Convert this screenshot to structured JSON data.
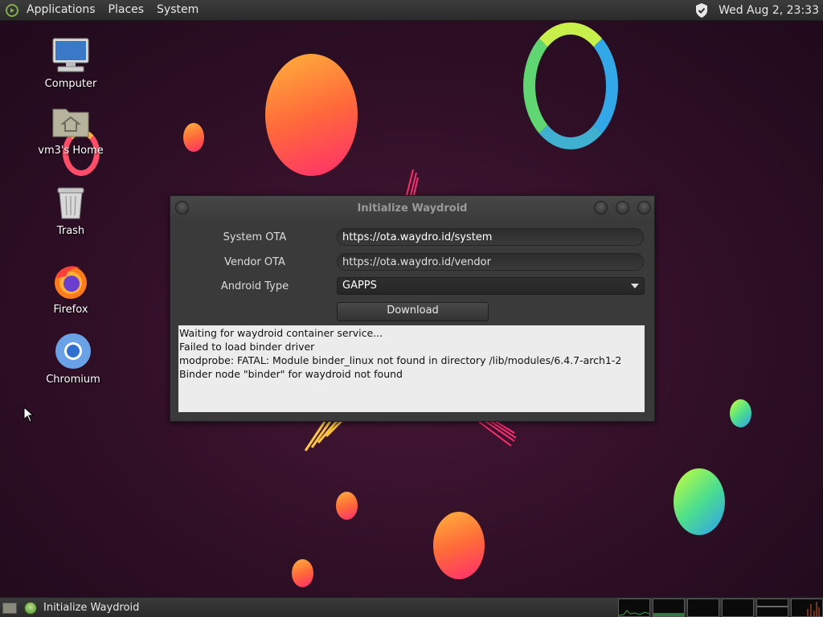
{
  "top_panel": {
    "menus": [
      "Applications",
      "Places",
      "System"
    ],
    "clock": "Wed Aug  2, 23:33",
    "icons": {
      "app_menu": "app-menu-icon",
      "shield": "shield-icon"
    }
  },
  "desktop": {
    "icons": [
      {
        "label": "Computer",
        "icon": "computer-icon"
      },
      {
        "label": "vm3's Home",
        "icon": "home-folder-icon"
      },
      {
        "label": "Trash",
        "icon": "trash-icon"
      },
      {
        "label": "Firefox",
        "icon": "firefox-icon"
      },
      {
        "label": "Chromium",
        "icon": "chromium-icon"
      }
    ]
  },
  "dialog": {
    "title": "Initialize Waydroid",
    "system_ota_label": "System OTA",
    "system_ota_value": "https://ota.waydro.id/system",
    "vendor_ota_label": "Vendor OTA",
    "vendor_ota_value": "https://ota.waydro.id/vendor",
    "android_type_label": "Android Type",
    "android_type_value": "GAPPS",
    "download_label": "Download",
    "log_lines": [
      "Waiting for waydroid container service...",
      "Failed to load binder driver",
      "modprobe: FATAL: Module binder_linux not found in directory /lib/modules/6.4.7-arch1-2",
      "Binder node \"binder\" for waydroid not found"
    ]
  },
  "bottom_panel": {
    "task_label": "Initialize Waydroid",
    "icons": {
      "show_desktop": "show-desktop-icon",
      "task": "waydroid-icon"
    }
  },
  "colors": {
    "panel_bg": "#2b2b2b",
    "dialog_bg": "#3a3a3a",
    "log_bg": "#ececec",
    "accent_green": "#7fb04a"
  }
}
